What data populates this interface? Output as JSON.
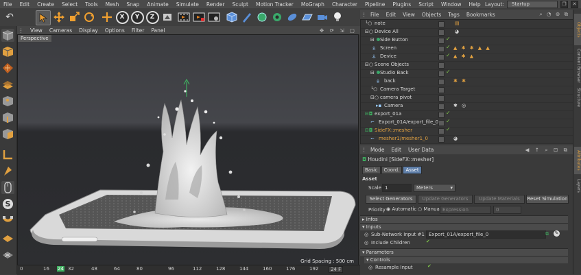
{
  "menubar": {
    "items": [
      "File",
      "Edit",
      "Create",
      "Select",
      "Tools",
      "Mesh",
      "Snap",
      "Animate",
      "Simulate",
      "Render",
      "Sculpt",
      "Motion Tracker",
      "MoGraph",
      "Character",
      "Pipeline",
      "Plugins",
      "Script",
      "Window",
      "Help"
    ],
    "layout_label": "Layout:",
    "layout_value": "Startup"
  },
  "toolbar": {
    "axis_x": "X",
    "axis_y": "Y",
    "axis_z": "Z"
  },
  "viewport": {
    "menu": [
      "View",
      "Cameras",
      "Display",
      "Options",
      "Filter",
      "Panel"
    ],
    "label": "Perspective",
    "grid_spacing": "Grid Spacing : 500 cm"
  },
  "timeline": {
    "ticks": [
      "0",
      "16",
      "24",
      "32",
      "48",
      "64",
      "80",
      "96",
      "112",
      "128",
      "144",
      "160",
      "176",
      "192",
      "208"
    ],
    "current_frame_marker": "24",
    "frame_display": "24 F"
  },
  "object_manager": {
    "menu": [
      "File",
      "Edit",
      "View",
      "Objects",
      "Tags",
      "Bookmarks"
    ],
    "rows": [
      {
        "name": "note",
        "indent": 0,
        "tags": ""
      },
      {
        "name": "Device All",
        "indent": 0,
        "tags": ""
      },
      {
        "name": "Side Button",
        "indent": 1,
        "tags": ""
      },
      {
        "name": "Screen",
        "indent": 1,
        "tags": "▲ ✱ ✱ ▲ ▲"
      },
      {
        "name": "Device",
        "indent": 1,
        "tags": "▲ ✱ ▲"
      },
      {
        "name": "Scene Objects",
        "indent": 0,
        "tags": ""
      },
      {
        "name": "Studio Back",
        "indent": 1,
        "tags": ""
      },
      {
        "name": "back",
        "indent": 2,
        "tags": "✱ ✱"
      },
      {
        "name": "Camera Target",
        "indent": 1,
        "tags": ""
      },
      {
        "name": "camera pivot",
        "indent": 1,
        "tags": ""
      },
      {
        "name": "Camera",
        "indent": 2,
        "tags": "✱ ◎"
      },
      {
        "name": "export_01a",
        "indent": 0,
        "tags": ""
      },
      {
        "name": "Export_01A/export_file_0",
        "indent": 1,
        "tags": ""
      },
      {
        "name": "SideFX::mesher",
        "indent": 0,
        "tags": "",
        "highlight": true
      },
      {
        "name": "mesher1/mesher1_0",
        "indent": 1,
        "tags": "",
        "highlight": true
      }
    ]
  },
  "side_tabs": {
    "top": [
      "Objects",
      "Content Browser",
      "Structure"
    ],
    "bottom": [
      "Attributes",
      "Layers"
    ]
  },
  "attributes": {
    "menu": [
      "Mode",
      "Edit",
      "User Data"
    ],
    "title": "Houdini [SideFX::mesher]",
    "tabs": [
      "Basic",
      "Coord.",
      "Asset"
    ],
    "active_tab": "Asset",
    "section_asset": "Asset",
    "scale_label": "Scale",
    "scale_value": "1",
    "scale_unit": "Meters",
    "btn_select_generators": "Select Generators",
    "btn_update_generators": "Update Generators",
    "btn_update_materials": "Update Materials",
    "btn_reset_simulation": "Reset Simulation",
    "priority_label": "Priority",
    "priority_automatic": "Automatic",
    "priority_manual": "Manual",
    "priority_expression": "Expression",
    "priority_value": "0",
    "section_infos": "Infos",
    "section_inputs": "Inputs",
    "subnet_input_label": "Sub-Network Input #1",
    "subnet_input_value": "Export_01A/export_file_0",
    "include_children_label": "Include Children",
    "section_parameters": "Parameters",
    "section_controls": "Controls",
    "resample_input_label": "Resample Input"
  },
  "colors": {
    "accent": "#5e7ea8",
    "highlight_orange": "#e0a040",
    "check_green": "#7ec44a"
  }
}
